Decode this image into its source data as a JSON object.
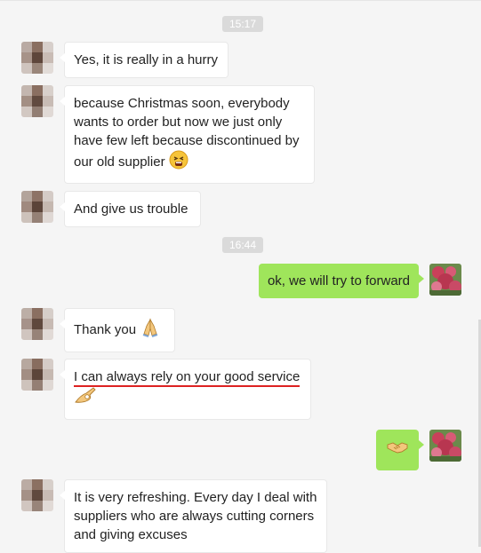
{
  "colors": {
    "peer_bubble": "#ffffff",
    "my_bubble": "#9fe55b",
    "timestamp_bg": "#dadada",
    "underline": "#dd2222"
  },
  "messages": [
    {
      "kind": "timestamp",
      "text": "15:17"
    },
    {
      "kind": "peer",
      "text": "Yes, it is really in a hurry"
    },
    {
      "kind": "peer",
      "text": "because Christmas soon, everybody wants to order but now we just only have few left because discontinued by our old supplier",
      "emoji": "tired-face-icon"
    },
    {
      "kind": "peer",
      "text": "And give us trouble"
    },
    {
      "kind": "timestamp",
      "text": "16:44"
    },
    {
      "kind": "me",
      "text": "ok, we will try to forward"
    },
    {
      "kind": "peer",
      "text": "Thank you",
      "emoji": "folded-hands-icon"
    },
    {
      "kind": "peer",
      "text": "I can always rely on your good service",
      "emoji": "ok-hand-icon",
      "underlined": true
    },
    {
      "kind": "me",
      "text": "",
      "emoji": "handshake-icon"
    },
    {
      "kind": "peer",
      "text": "It is very refreshing. Every day I deal with suppliers who are always cutting corners and giving excuses"
    }
  ]
}
